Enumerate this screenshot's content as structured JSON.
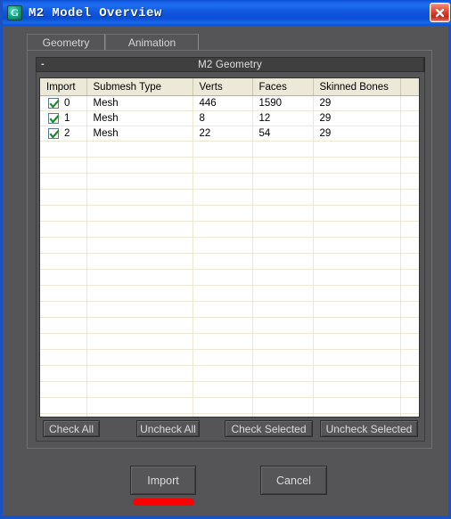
{
  "window": {
    "title": "M2 Model Overview",
    "icon": "app-logo-icon",
    "close_label": "×",
    "accent_color": "#1a52c4",
    "body_color": "#555456"
  },
  "tabs": [
    {
      "id": "geometry",
      "label": "Geometry",
      "active": true
    },
    {
      "id": "animation",
      "label": "Animation",
      "active": false
    }
  ],
  "rollout": {
    "title": "M2 Geometry",
    "collapse_glyph": "-",
    "expanded": true
  },
  "grid": {
    "columns": [
      "Import",
      "Submesh Type",
      "Verts",
      "Faces",
      "Skinned Bones",
      ""
    ],
    "rows": [
      {
        "checked": true,
        "index": "0",
        "type": "Mesh",
        "verts": "446",
        "faces": "1590",
        "bones": "29"
      },
      {
        "checked": true,
        "index": "1",
        "type": "Mesh",
        "verts": "8",
        "faces": "12",
        "bones": "29"
      },
      {
        "checked": true,
        "index": "2",
        "type": "Mesh",
        "verts": "22",
        "faces": "54",
        "bones": "29"
      }
    ],
    "empty_row_count": 21,
    "header_bg": "#ECE9D8",
    "gridline_color": "#EBE8D6"
  },
  "check_buttons": [
    {
      "id": "check-all",
      "label": "Check All"
    },
    {
      "id": "uncheck-all",
      "label": "Uncheck All"
    },
    {
      "id": "check-selected",
      "label": "Check Selected"
    },
    {
      "id": "uncheck-selected",
      "label": "Uncheck Selected"
    }
  ],
  "footer": {
    "import_label": "Import",
    "cancel_label": "Cancel",
    "highlight_color": "#fe0000"
  }
}
